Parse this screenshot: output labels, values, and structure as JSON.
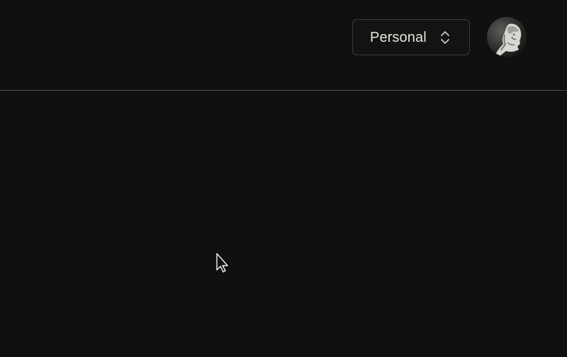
{
  "header": {
    "workspace_selector": {
      "value": "Personal",
      "icon": "chevron-up-down-icon"
    },
    "avatar": {
      "icon": "user-avatar-statue"
    }
  },
  "colors": {
    "background": "#0f100f",
    "divider": "#4a4b47",
    "text": "#e4e4e0"
  }
}
